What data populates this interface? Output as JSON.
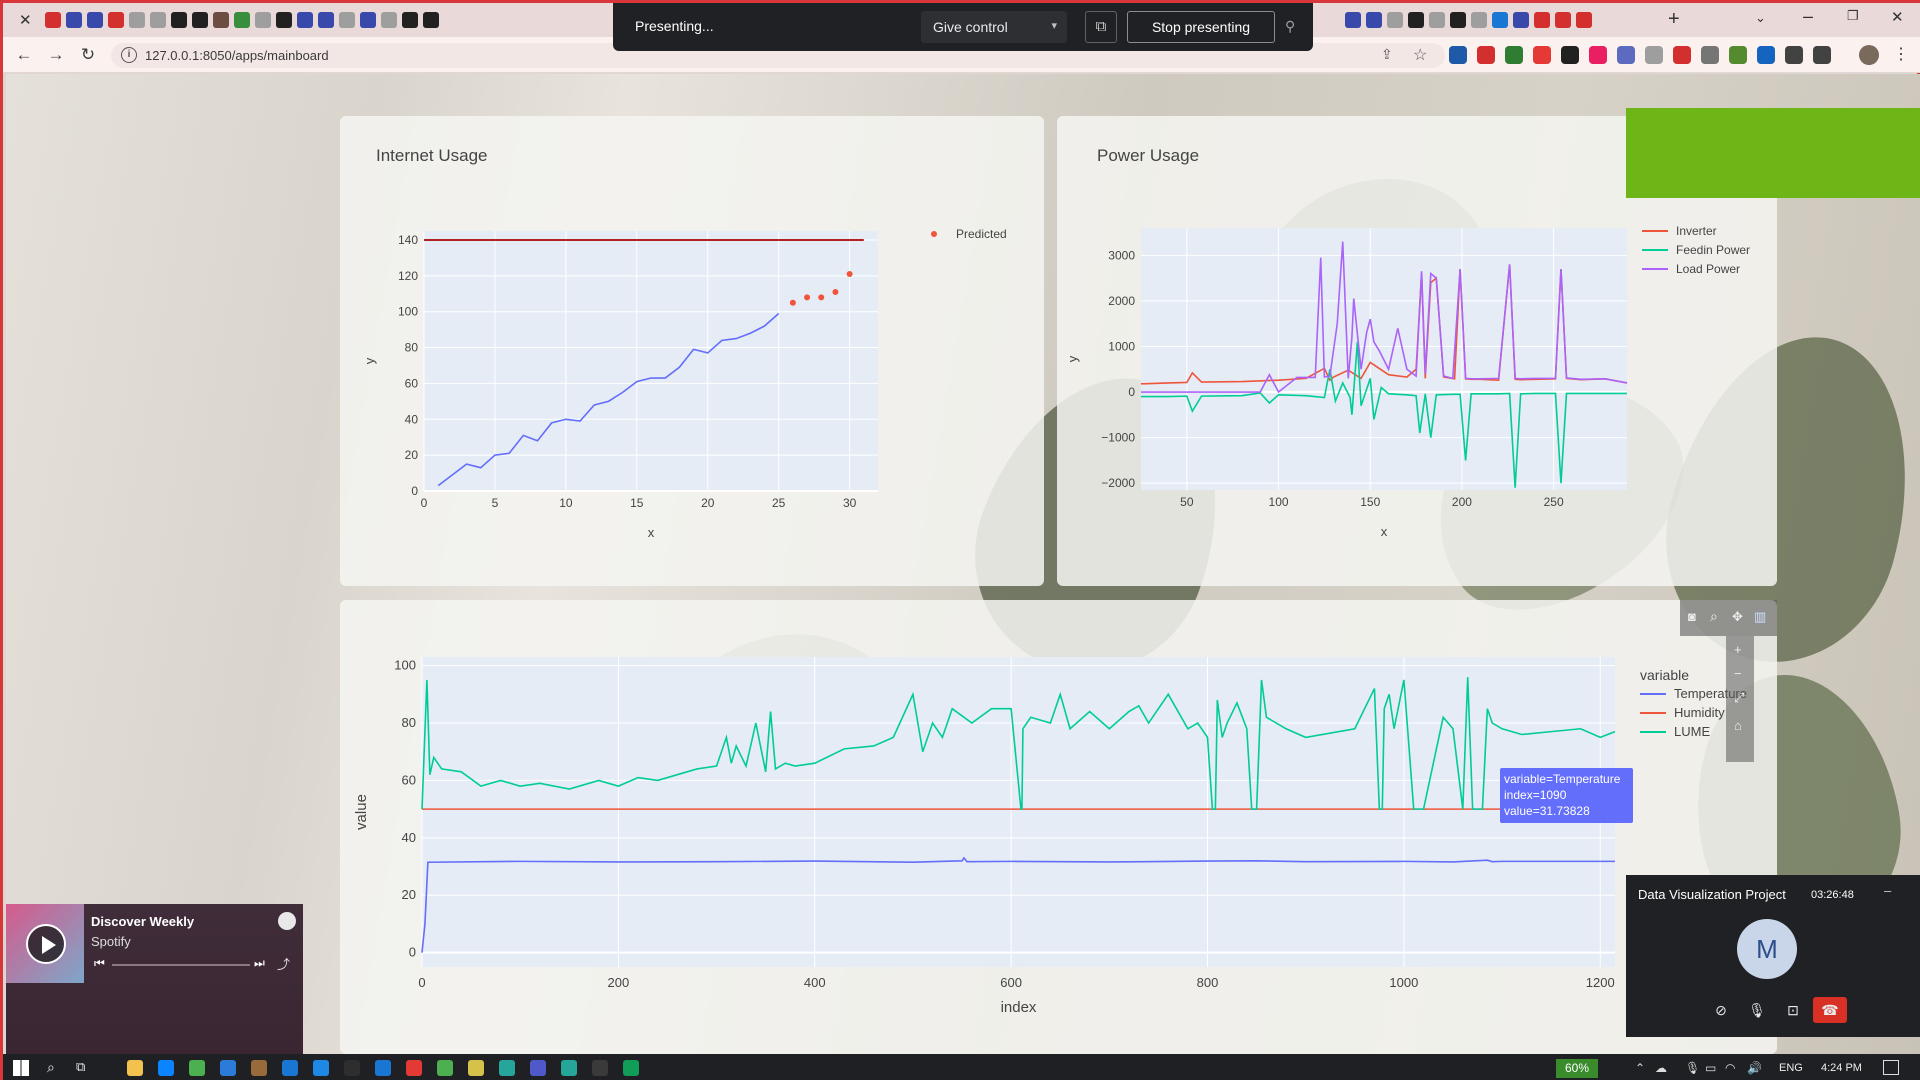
{
  "browser": {
    "url": "127.0.0.1:8050/apps/mainboard",
    "presenting": {
      "status": "Presenting...",
      "give_control": "Give control",
      "stop": "Stop presenting"
    }
  },
  "charts": {
    "internet": {
      "title": "Internet Usage"
    },
    "power": {
      "title": "Power Usage"
    }
  },
  "chart_data": [
    {
      "type": "line",
      "title": "Internet Usage",
      "xlabel": "x",
      "ylabel": "y",
      "xlim": [
        0,
        32
      ],
      "ylim": [
        0,
        145
      ],
      "xticks": [
        0,
        5,
        10,
        15,
        20,
        25,
        30
      ],
      "yticks": [
        0,
        20,
        40,
        60,
        80,
        100,
        120,
        140
      ],
      "grid": true,
      "legend": "top-right",
      "series": [
        {
          "kind": "line",
          "color": "#636efa",
          "x": [
            1,
            2,
            3,
            4,
            5,
            6,
            7,
            8,
            9,
            10,
            11,
            12,
            13,
            14,
            15,
            16,
            17,
            18,
            19,
            20,
            21,
            22,
            23,
            24,
            25
          ],
          "y": [
            3,
            9,
            15,
            13,
            20,
            21,
            31,
            28,
            38,
            40,
            39,
            48,
            50,
            55,
            61,
            63,
            63,
            69,
            79,
            77,
            84,
            85,
            88,
            92,
            99
          ]
        },
        {
          "kind": "scatter",
          "name": "Predicted",
          "color": "#ef553b",
          "x": [
            26,
            27,
            28,
            29,
            30
          ],
          "y": [
            105,
            108,
            108,
            111,
            121
          ]
        },
        {
          "kind": "hline",
          "color": "#b22222",
          "y": 140,
          "x": [
            0,
            31
          ]
        }
      ]
    },
    {
      "type": "line",
      "title": "Power Usage",
      "xlabel": "x",
      "ylabel": "y",
      "xlim": [
        25,
        290
      ],
      "ylim": [
        -2150,
        3600
      ],
      "xticks": [
        50,
        100,
        150,
        200,
        250
      ],
      "yticks": [
        -2000,
        -1000,
        0,
        1000,
        2000,
        3000
      ],
      "grid": true,
      "legend": "top-right",
      "series": [
        {
          "name": "Inverter",
          "color": "#ef553b",
          "x": [
            25,
            40,
            50,
            53,
            58,
            80,
            100,
            115,
            125,
            128,
            130,
            138,
            145,
            150,
            160,
            170,
            175,
            178,
            180,
            183,
            186,
            190,
            196,
            199,
            202,
            206,
            210,
            220,
            226,
            229,
            232,
            240,
            251,
            254,
            257,
            265,
            278,
            290
          ],
          "y": [
            180,
            200,
            210,
            420,
            220,
            230,
            260,
            300,
            520,
            260,
            330,
            480,
            300,
            650,
            380,
            330,
            500,
            2600,
            300,
            2400,
            2500,
            330,
            290,
            2700,
            290,
            280,
            280,
            260,
            2800,
            280,
            270,
            280,
            290,
            2700,
            300,
            270,
            290,
            200
          ]
        },
        {
          "name": "Feedin Power",
          "color": "#00cc96",
          "x": [
            25,
            40,
            50,
            53,
            58,
            80,
            90,
            95,
            100,
            115,
            125,
            128,
            131,
            135,
            139,
            140,
            143,
            145,
            150,
            152,
            156,
            160,
            170,
            175,
            177,
            180,
            183,
            186,
            195,
            199,
            202,
            205,
            210,
            220,
            226,
            229,
            232,
            240,
            251,
            254,
            257,
            265,
            278,
            290
          ],
          "y": [
            -100,
            -100,
            -90,
            -420,
            -90,
            -80,
            -20,
            -240,
            -60,
            -80,
            -120,
            500,
            -200,
            200,
            -120,
            -500,
            1100,
            -300,
            300,
            -600,
            100,
            -40,
            -60,
            -80,
            -900,
            -40,
            -1000,
            -60,
            -50,
            -50,
            -1500,
            -40,
            -40,
            -40,
            -30,
            -2100,
            -40,
            -30,
            -30,
            -2000,
            -30,
            -30,
            -30,
            -30
          ]
        },
        {
          "name": "Load Power",
          "color": "#ab63fa",
          "x": [
            25,
            40,
            50,
            80,
            90,
            95,
            100,
            110,
            120,
            123,
            125,
            128,
            132,
            135,
            138,
            140,
            141,
            145,
            148,
            150,
            152,
            155,
            160,
            165,
            170,
            175,
            178,
            180,
            183,
            186,
            190,
            195,
            199,
            202,
            206,
            210,
            220,
            226,
            229,
            232,
            240,
            251,
            254,
            257,
            265,
            278,
            290
          ],
          "y": [
            0,
            0,
            0,
            0,
            0,
            380,
            0,
            320,
            320,
            2950,
            330,
            350,
            1500,
            3300,
            300,
            1200,
            2050,
            500,
            1300,
            1600,
            1100,
            900,
            500,
            1400,
            500,
            350,
            2650,
            400,
            2600,
            2500,
            350,
            300,
            2700,
            300,
            290,
            290,
            300,
            2800,
            300,
            290,
            300,
            300,
            2700,
            310,
            280,
            290,
            200
          ]
        }
      ]
    },
    {
      "type": "line",
      "title": "",
      "xlabel": "index",
      "ylabel": "value",
      "xlim": [
        0,
        1215
      ],
      "ylim": [
        -5,
        103
      ],
      "xticks": [
        0,
        200,
        400,
        600,
        800,
        1000,
        1200
      ],
      "yticks": [
        0,
        20,
        40,
        60,
        80,
        100
      ],
      "grid": true,
      "legend": "top-right",
      "legend_title": "variable",
      "series": [
        {
          "name": "Temperature",
          "color": "#636efa",
          "x": [
            0,
            3,
            6,
            100,
            200,
            300,
            400,
            500,
            550,
            552,
            555,
            600,
            700,
            800,
            850,
            900,
            1000,
            1050,
            1085,
            1090,
            1100,
            1215
          ],
          "y": [
            0,
            10,
            31.5,
            31.8,
            31.6,
            31.7,
            31.9,
            31.5,
            32,
            33,
            31.7,
            31.8,
            31.6,
            31.9,
            32,
            31.7,
            31.8,
            31.6,
            32.2,
            31.7,
            31.8,
            31.8
          ]
        },
        {
          "name": "Humidity",
          "color": "#ef553b",
          "x": [
            0,
            1215
          ],
          "y": [
            50,
            50
          ]
        },
        {
          "name": "LUME",
          "color": "#00cc96",
          "x": [
            0,
            5,
            8,
            12,
            20,
            40,
            60,
            80,
            100,
            120,
            150,
            180,
            200,
            220,
            240,
            260,
            280,
            300,
            310,
            315,
            320,
            330,
            340,
            350,
            355,
            360,
            370,
            380,
            400,
            430,
            460,
            480,
            500,
            510,
            520,
            530,
            540,
            560,
            580,
            600,
            610,
            611,
            612,
            620,
            640,
            650,
            660,
            680,
            700,
            720,
            730,
            740,
            760,
            780,
            790,
            800,
            805,
            808,
            810,
            815,
            820,
            830,
            840,
            845,
            850,
            855,
            860,
            880,
            900,
            950,
            970,
            975,
            978,
            980,
            985,
            990,
            1000,
            1010,
            1020,
            1040,
            1050,
            1060,
            1065,
            1070,
            1080,
            1085,
            1090,
            1100,
            1120,
            1150,
            1180,
            1200,
            1215
          ],
          "y": [
            50,
            95,
            62,
            68,
            64,
            63,
            58,
            60,
            58,
            59,
            57,
            60,
            58,
            61,
            60,
            62,
            64,
            65,
            75,
            66,
            72,
            65,
            80,
            63,
            84,
            64,
            66,
            65,
            66,
            71,
            72,
            75,
            90,
            70,
            80,
            75,
            85,
            80,
            85,
            85,
            50,
            50,
            78,
            82,
            80,
            90,
            78,
            84,
            78,
            84,
            86,
            80,
            90,
            78,
            80,
            75,
            50,
            50,
            88,
            75,
            80,
            87,
            78,
            50,
            50,
            95,
            82,
            78,
            75,
            78,
            92,
            50,
            50,
            85,
            90,
            78,
            95,
            50,
            50,
            82,
            78,
            50,
            96,
            50,
            50,
            85,
            80,
            78,
            76,
            77,
            78,
            75,
            77
          ]
        }
      ],
      "tooltip": {
        "variable": "Temperature",
        "index": 1090,
        "value": 31.73828
      },
      "modebar": [
        "camera-icon",
        "zoom-icon",
        "pan-icon",
        "bar-icon"
      ]
    }
  ],
  "text": {
    "tooltip_variable": "variable=Temperature",
    "tooltip_index": "index=1090",
    "tooltip_value": "value=31.73828",
    "legend_variable": "variable"
  },
  "spotify": {
    "title": "Discover Weekly",
    "subtitle": "Spotify"
  },
  "meet": {
    "title": "Data Visualization Project",
    "duration": "03:26:48",
    "avatar_letter": "M"
  },
  "taskbar": {
    "zoom": "60%",
    "lang": "ENG",
    "time": "4:24 PM"
  },
  "colors": {
    "green_block": "#6eb518",
    "window_border": "#d8363b",
    "plot_bg": "#e5ecf6"
  }
}
